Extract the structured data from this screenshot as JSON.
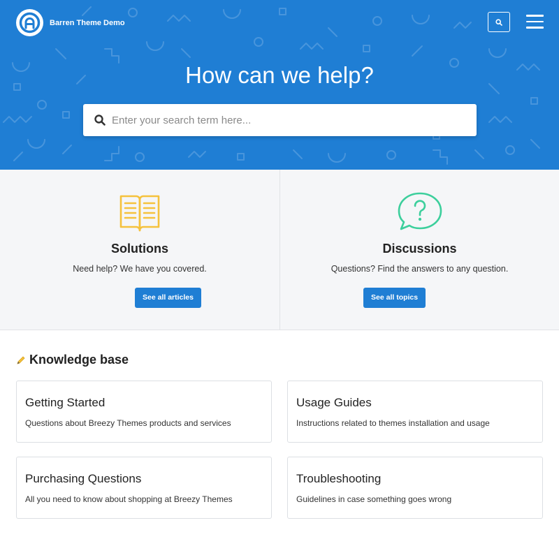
{
  "header": {
    "brand_name": "Barren Theme Demo",
    "logo_letter": "A",
    "search_button": "search-icon",
    "menu_button": "hamburger-menu-icon"
  },
  "hero": {
    "title": "How can we help?",
    "search_placeholder": "Enter your search term here...",
    "background_color": "#1f7ed4"
  },
  "panels": [
    {
      "icon": "open-book-icon",
      "icon_color": "#f5c23d",
      "title": "Solutions",
      "description": "Need help? We have you covered.",
      "button_label": "See all articles"
    },
    {
      "icon": "question-speech-bubble-icon",
      "icon_color": "#3ccf9c",
      "title": "Discussions",
      "description": "Questions? Find the answers to any question.",
      "button_label": "See all topics"
    }
  ],
  "knowledge_base": {
    "icon": "pencil-icon",
    "title": "Knowledge base",
    "categories": [
      {
        "title": "Getting Started",
        "description": "Questions about Breezy Themes products and services"
      },
      {
        "title": "Usage Guides",
        "description": "Instructions related to themes installation and usage"
      },
      {
        "title": "Purchasing Questions",
        "description": "All you need to know about shopping at Breezy Themes"
      },
      {
        "title": "Troubleshooting",
        "description": "Guidelines in case something goes wrong"
      }
    ]
  },
  "colors": {
    "accent": "#1f7ed4",
    "panel_background": "#f5f6f8"
  }
}
